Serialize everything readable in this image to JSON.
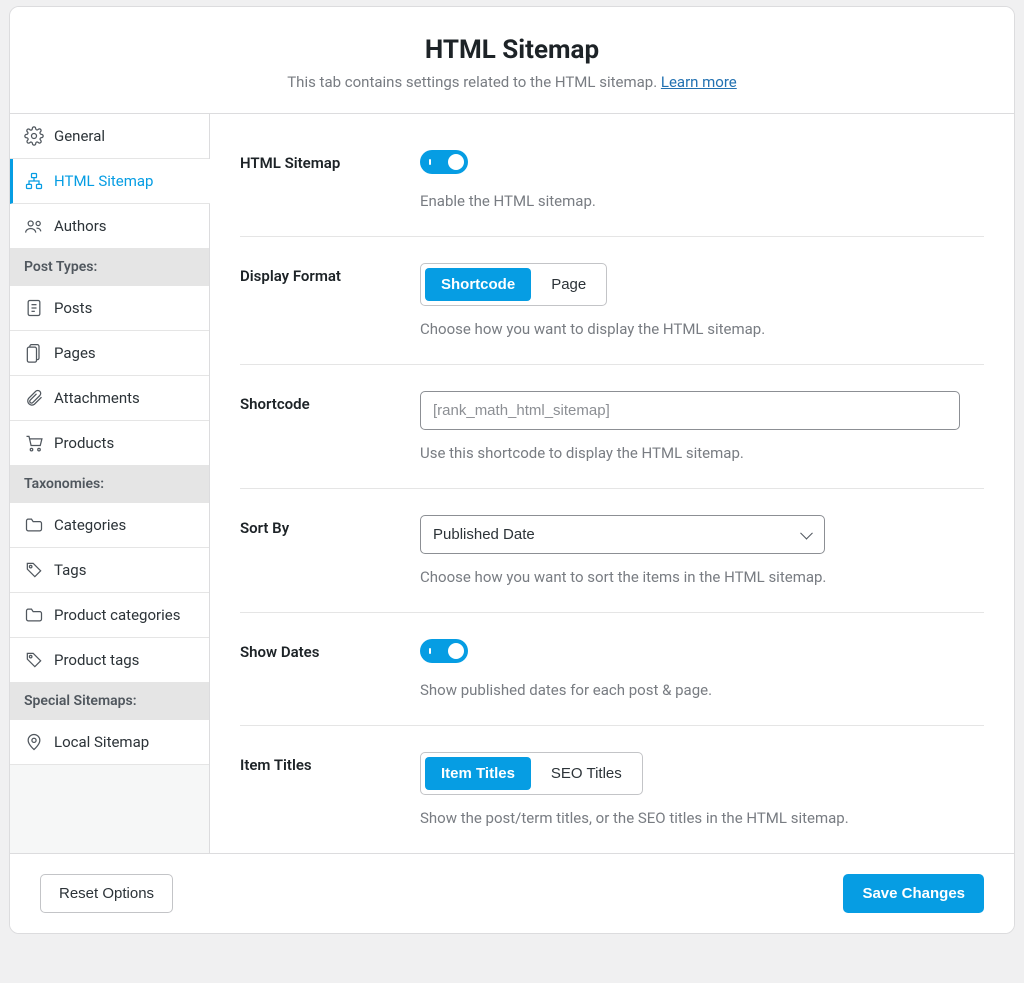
{
  "header": {
    "title": "HTML Sitemap",
    "subtitle_prefix": "This tab contains settings related to the HTML sitemap. ",
    "learn_more": "Learn more"
  },
  "sidebar": {
    "items": [
      {
        "label": "General",
        "icon": "gear-icon",
        "type": "item"
      },
      {
        "label": "HTML Sitemap",
        "icon": "sitemap-icon",
        "type": "item",
        "active": true
      },
      {
        "label": "Authors",
        "icon": "users-icon",
        "type": "item"
      },
      {
        "label": "Post Types:",
        "type": "header"
      },
      {
        "label": "Posts",
        "icon": "post-icon",
        "type": "item"
      },
      {
        "label": "Pages",
        "icon": "page-icon",
        "type": "item"
      },
      {
        "label": "Attachments",
        "icon": "attachment-icon",
        "type": "item"
      },
      {
        "label": "Products",
        "icon": "cart-icon",
        "type": "item"
      },
      {
        "label": "Taxonomies:",
        "type": "header"
      },
      {
        "label": "Categories",
        "icon": "folder-icon",
        "type": "item"
      },
      {
        "label": "Tags",
        "icon": "tag-icon",
        "type": "item"
      },
      {
        "label": "Product categories",
        "icon": "folder-icon",
        "type": "item"
      },
      {
        "label": "Product tags",
        "icon": "tag-icon",
        "type": "item"
      },
      {
        "label": "Special Sitemaps:",
        "type": "header"
      },
      {
        "label": "Local Sitemap",
        "icon": "pin-icon",
        "type": "item"
      }
    ]
  },
  "fields": {
    "html_sitemap": {
      "label": "HTML Sitemap",
      "desc": "Enable the HTML sitemap."
    },
    "display_format": {
      "label": "Display Format",
      "desc": "Choose how you want to display the HTML sitemap.",
      "options": {
        "shortcode": "Shortcode",
        "page": "Page"
      },
      "selected": "shortcode"
    },
    "shortcode": {
      "label": "Shortcode",
      "placeholder": "[rank_math_html_sitemap]",
      "desc": "Use this shortcode to display the HTML sitemap."
    },
    "sort_by": {
      "label": "Sort By",
      "value": "Published Date",
      "desc": "Choose how you want to sort the items in the HTML sitemap."
    },
    "show_dates": {
      "label": "Show Dates",
      "desc": "Show published dates for each post & page."
    },
    "item_titles": {
      "label": "Item Titles",
      "options": {
        "item": "Item Titles",
        "seo": "SEO Titles"
      },
      "selected": "item",
      "desc": "Show the post/term titles, or the SEO titles in the HTML sitemap."
    }
  },
  "footer": {
    "reset": "Reset Options",
    "save": "Save Changes"
  }
}
